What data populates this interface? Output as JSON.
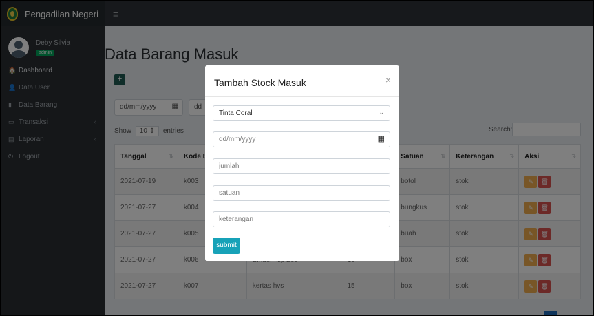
{
  "app": {
    "brand": "Pengadilan Negeri",
    "menu_toggle": "≡"
  },
  "user": {
    "name": "Deby Silvia",
    "role": "admin"
  },
  "sidebar": {
    "items": [
      {
        "icon": "🏠",
        "label": "Dashboard"
      },
      {
        "icon": "👤",
        "label": "Data User"
      },
      {
        "icon": "▮",
        "label": "Data Barang"
      },
      {
        "icon": "▭",
        "label": "Transaksi",
        "chevron": "‹"
      },
      {
        "icon": "▤",
        "label": "Laporan",
        "chevron": "‹"
      },
      {
        "icon": "⏻",
        "label": "Logout"
      }
    ]
  },
  "page": {
    "title": "Data Barang Masuk",
    "add_icon": "+",
    "date_placeholder": "dd/mm/yyyy",
    "date2_placeholder": "dd",
    "calendar_icon": "▦",
    "show_label": "Show",
    "entries_value": "10 ⇕",
    "entries_label": "entries",
    "search_label": "Search:"
  },
  "table": {
    "headers": [
      "Tanggal",
      "Kode Bara",
      "",
      "",
      "Satuan",
      "Keterangan",
      "Aksi"
    ],
    "sort_icon": "⇅",
    "rows": [
      [
        "2021-07-19",
        "k003",
        "",
        "",
        "botol",
        "stok"
      ],
      [
        "2021-07-27",
        "k004",
        "",
        "",
        "bungkus",
        "stok"
      ],
      [
        "2021-07-27",
        "k005",
        "",
        "",
        "buah",
        "stok"
      ],
      [
        "2021-07-27",
        "k006",
        "Binder klip 260",
        "10",
        "box",
        "stok"
      ],
      [
        "2021-07-27",
        "k007",
        "kertas hvs",
        "15",
        "box",
        "stok"
      ]
    ],
    "edit_icon": "✎",
    "delete_icon": "🗑"
  },
  "modal": {
    "title": "Tambah Stock Masuk",
    "close": "×",
    "select_value": "Tinta Coral",
    "select_chevron": "⌄",
    "date_placeholder": "dd/mm/yyyy",
    "calendar_icon": "▦",
    "jumlah_placeholder": "jumlah",
    "satuan_placeholder": "satuan",
    "keterangan_placeholder": "keterangan",
    "submit_label": "submit"
  },
  "colors": {
    "topbar": "#2e3338",
    "sidebar": "#2b2f33",
    "submit": "#17a2b8",
    "edit": "#f0ad4e",
    "delete": "#d9534f"
  }
}
